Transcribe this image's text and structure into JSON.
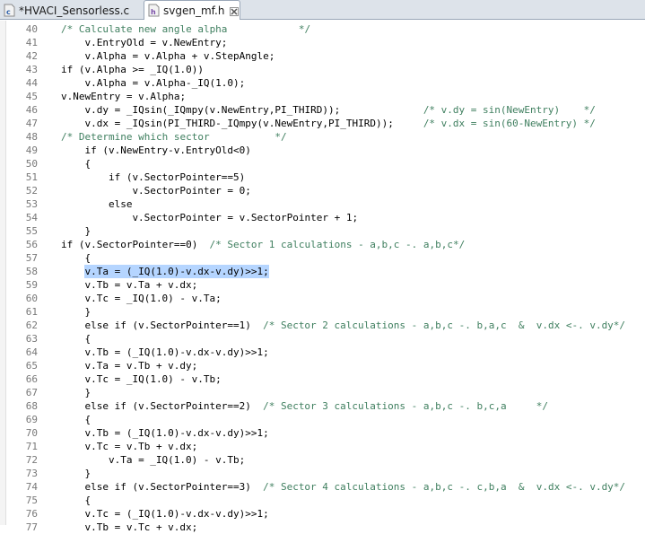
{
  "tabs": [
    {
      "label": "*HVACI_Sensorless.c",
      "icon": "c-file-icon",
      "active": false
    },
    {
      "label": "svgen_mf.h",
      "icon": "h-file-icon",
      "active": true
    }
  ],
  "lines": [
    {
      "n": "40",
      "indent": 0,
      "code": "/* Calculate new angle alpha            */",
      "comment": true
    },
    {
      "n": "41",
      "indent": 4,
      "code": "v.EntryOld = v.NewEntry;"
    },
    {
      "n": "42",
      "indent": 4,
      "code": "v.Alpha = v.Alpha + v.StepAngle;"
    },
    {
      "n": "43",
      "indent": 0,
      "code": "if (v.Alpha >= _IQ(1.0))"
    },
    {
      "n": "44",
      "indent": 4,
      "code": "v.Alpha = v.Alpha-_IQ(1.0);"
    },
    {
      "n": "45",
      "indent": 0,
      "code": "v.NewEntry = v.Alpha;",
      "outdent": true
    },
    {
      "n": "46",
      "indent": 4,
      "code": "v.dy = _IQsin(_IQmpy(v.NewEntry,PI_THIRD));",
      "tail": "/* v.dy = sin(NewEntry)    */",
      "tailcol": 61
    },
    {
      "n": "47",
      "indent": 4,
      "code": "v.dx = _IQsin(PI_THIRD-_IQmpy(v.NewEntry,PI_THIRD));",
      "tail": "/* v.dx = sin(60-NewEntry) */",
      "tailcol": 61
    },
    {
      "n": "48",
      "indent": 0,
      "code": "/* Determine which sector           */",
      "comment": true
    },
    {
      "n": "49",
      "indent": 4,
      "code": "if (v.NewEntry-v.EntryOld<0)"
    },
    {
      "n": "50",
      "indent": 4,
      "code": "{"
    },
    {
      "n": "51",
      "indent": 8,
      "code": "if (v.SectorPointer==5)"
    },
    {
      "n": "52",
      "indent": 12,
      "code": "v.SectorPointer = 0;"
    },
    {
      "n": "53",
      "indent": 8,
      "code": "else"
    },
    {
      "n": "54",
      "indent": 12,
      "code": "v.SectorPointer = v.SectorPointer + 1;"
    },
    {
      "n": "55",
      "indent": 4,
      "code": "}"
    },
    {
      "n": "56",
      "indent": 0,
      "code": "if (v.SectorPointer==0)",
      "tail": "/* Sector 1 calculations - a,b,c -. a,b,c*/",
      "tailcol": 25
    },
    {
      "n": "57",
      "indent": 4,
      "code": "{"
    },
    {
      "n": "58",
      "indent": 4,
      "code": "v.Ta = (_IQ(1.0)-v.dx-v.dy)>>1;",
      "selected": true
    },
    {
      "n": "59",
      "indent": 4,
      "code": "v.Tb = v.Ta + v.dx;"
    },
    {
      "n": "60",
      "indent": 4,
      "code": "v.Tc = _IQ(1.0) - v.Ta;"
    },
    {
      "n": "61",
      "indent": 4,
      "code": "}"
    },
    {
      "n": "62",
      "indent": 4,
      "code": "else if (v.SectorPointer==1)",
      "tail": "/* Sector 2 calculations - a,b,c -. b,a,c  &  v.dx <-. v.dy*/",
      "tailcol": 34
    },
    {
      "n": "63",
      "indent": 4,
      "code": "{"
    },
    {
      "n": "64",
      "indent": 4,
      "code": "v.Tb = (_IQ(1.0)-v.dx-v.dy)>>1;"
    },
    {
      "n": "65",
      "indent": 4,
      "code": "v.Ta = v.Tb + v.dy;"
    },
    {
      "n": "66",
      "indent": 4,
      "code": "v.Tc = _IQ(1.0) - v.Tb;"
    },
    {
      "n": "67",
      "indent": 4,
      "code": "}"
    },
    {
      "n": "68",
      "indent": 4,
      "code": "else if (v.SectorPointer==2)",
      "tail": "/* Sector 3 calculations - a,b,c -. b,c,a     */",
      "tailcol": 34
    },
    {
      "n": "69",
      "indent": 4,
      "code": "{"
    },
    {
      "n": "70",
      "indent": 4,
      "code": "v.Tb = (_IQ(1.0)-v.dx-v.dy)>>1;"
    },
    {
      "n": "71",
      "indent": 4,
      "code": "v.Tc = v.Tb + v.dx;"
    },
    {
      "n": "72",
      "indent": 8,
      "code": "v.Ta = _IQ(1.0) - v.Tb;"
    },
    {
      "n": "73",
      "indent": 4,
      "code": "}"
    },
    {
      "n": "74",
      "indent": 4,
      "code": "else if (v.SectorPointer==3)",
      "tail": "/* Sector 4 calculations - a,b,c -. c,b,a  &  v.dx <-. v.dy*/",
      "tailcol": 34
    },
    {
      "n": "75",
      "indent": 4,
      "code": "{"
    },
    {
      "n": "76",
      "indent": 4,
      "code": "v.Tc = (_IQ(1.0)-v.dx-v.dy)>>1;"
    },
    {
      "n": "77",
      "indent": 4,
      "code": "v.Tb = v.Tc + v.dx;",
      "partial": true
    }
  ],
  "colors": {
    "comment": "#3f7f5f",
    "selection": "#b5d5ff",
    "line_number": "#787878"
  }
}
